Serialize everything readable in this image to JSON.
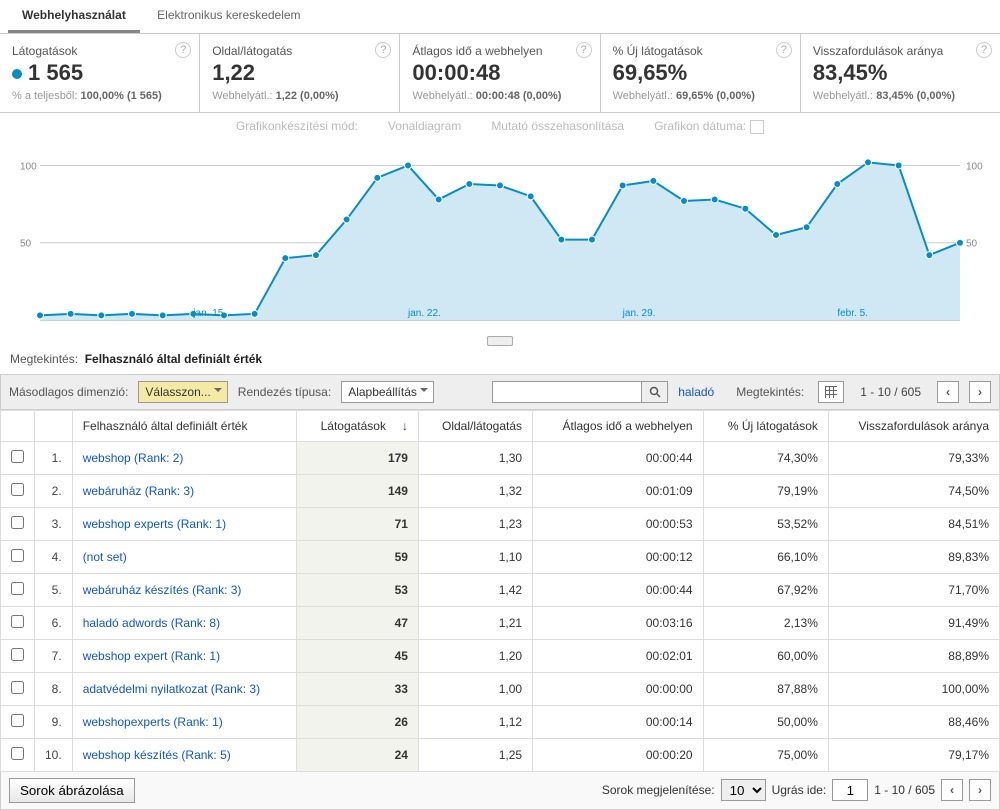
{
  "tabs": {
    "site_usage": "Webhelyhasználat",
    "ecommerce": "Elektronikus kereskedelem"
  },
  "scorecards": {
    "visits": {
      "label": "Látogatások",
      "value": "1 565",
      "sub_prefix": "% a teljesből: ",
      "sub_value": "100,00% (1 565)"
    },
    "pages": {
      "label": "Oldal/látogatás",
      "value": "1,22",
      "sub_prefix": "Webhelyátl.: ",
      "sub_value": "1,22 (0,00%)"
    },
    "avgtime": {
      "label": "Átlagos idő a webhelyen",
      "value": "00:00:48",
      "sub_prefix": "Webhelyátl.: ",
      "sub_value": "00:00:48 (0,00%)"
    },
    "newvisits": {
      "label": "% Új látogatások",
      "value": "69,65%",
      "sub_prefix": "Webhelyátl.: ",
      "sub_value": "69,65% (0,00%)"
    },
    "bounce": {
      "label": "Visszafordulások aránya",
      "value": "83,45%",
      "sub_prefix": "Webhelyátl.: ",
      "sub_value": "83,45% (0,00%)"
    }
  },
  "chart_controls": {
    "mode": "Grafikonkészítési mód:",
    "line": "Vonaldiagram",
    "compare": "Mutató összehasonlítása",
    "date": "Grafikon dátuma:"
  },
  "chart_data": {
    "type": "area",
    "ylim": [
      0,
      110
    ],
    "yticks": [
      50,
      100
    ],
    "x_labels": [
      {
        "i": 5,
        "label": "jan. 15."
      },
      {
        "i": 12,
        "label": "jan. 22."
      },
      {
        "i": 19,
        "label": "jan. 29."
      },
      {
        "i": 26,
        "label": "febr. 5."
      }
    ],
    "values": [
      3,
      4,
      3,
      4,
      3,
      4,
      3,
      4,
      40,
      42,
      65,
      92,
      100,
      78,
      88,
      87,
      80,
      52,
      52,
      87,
      90,
      77,
      78,
      72,
      55,
      60,
      88,
      102,
      100,
      42,
      50
    ]
  },
  "view_row": {
    "prefix": "Megtekintés:",
    "value": "Felhasználó által definiált érték"
  },
  "toolbar": {
    "dim_label": "Másodlagos dimenzió:",
    "dim_value": "Válasszon...",
    "sort_label": "Rendezés típusa:",
    "sort_value": "Alapbeállítás",
    "advanced": "haladó",
    "view_label": "Megtekintés:",
    "pager": "1 - 10 / 605",
    "prev": "‹",
    "next": "›"
  },
  "table": {
    "headers": {
      "user_defined": "Felhasználó által definiált érték",
      "visits": "Látogatások",
      "pages": "Oldal/látogatás",
      "avgtime": "Átlagos idő a webhelyen",
      "newvisits": "% Új látogatások",
      "bounce": "Visszafordulások aránya",
      "sort_arrow": "↓"
    },
    "rows": [
      {
        "n": "1.",
        "name": "webshop (Rank: 2)",
        "visits": "179",
        "pages": "1,30",
        "avg": "00:00:44",
        "new": "74,30%",
        "bounce": "79,33%"
      },
      {
        "n": "2.",
        "name": "webáruház (Rank: 3)",
        "visits": "149",
        "pages": "1,32",
        "avg": "00:01:09",
        "new": "79,19%",
        "bounce": "74,50%"
      },
      {
        "n": "3.",
        "name": "webshop experts (Rank: 1)",
        "visits": "71",
        "pages": "1,23",
        "avg": "00:00:53",
        "new": "53,52%",
        "bounce": "84,51%"
      },
      {
        "n": "4.",
        "name": "(not set)",
        "visits": "59",
        "pages": "1,10",
        "avg": "00:00:12",
        "new": "66,10%",
        "bounce": "89,83%"
      },
      {
        "n": "5.",
        "name": "webáruház készítés (Rank: 3)",
        "visits": "53",
        "pages": "1,42",
        "avg": "00:00:44",
        "new": "67,92%",
        "bounce": "71,70%"
      },
      {
        "n": "6.",
        "name": "haladó adwords (Rank: 8)",
        "visits": "47",
        "pages": "1,21",
        "avg": "00:03:16",
        "new": "2,13%",
        "bounce": "91,49%"
      },
      {
        "n": "7.",
        "name": "webshop expert (Rank: 1)",
        "visits": "45",
        "pages": "1,20",
        "avg": "00:02:01",
        "new": "60,00%",
        "bounce": "88,89%"
      },
      {
        "n": "8.",
        "name": "adatvédelmi nyilatkozat (Rank: 3)",
        "visits": "33",
        "pages": "1,00",
        "avg": "00:00:00",
        "new": "87,88%",
        "bounce": "100,00%"
      },
      {
        "n": "9.",
        "name": "webshopexperts (Rank: 1)",
        "visits": "26",
        "pages": "1,12",
        "avg": "00:00:14",
        "new": "50,00%",
        "bounce": "88,46%"
      },
      {
        "n": "10.",
        "name": "webshop készítés (Rank: 5)",
        "visits": "24",
        "pages": "1,25",
        "avg": "00:00:20",
        "new": "75,00%",
        "bounce": "79,17%"
      }
    ]
  },
  "footer": {
    "plot": "Sorok ábrázolása",
    "rows_label": "Sorok megjelenítése:",
    "rows_value": "10",
    "goto_label": "Ugrás ide:",
    "goto_value": "1",
    "pager": "1 - 10 / 605",
    "prev": "‹",
    "next": "›"
  }
}
